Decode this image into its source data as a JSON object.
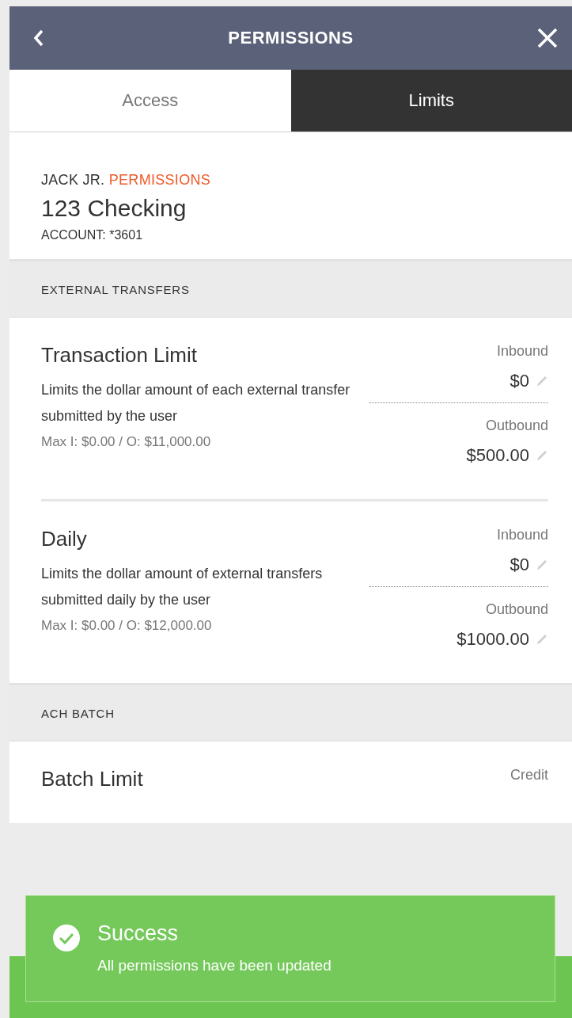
{
  "header": {
    "title": "PERMISSIONS"
  },
  "tabs": [
    {
      "label": "Access",
      "selected": false
    },
    {
      "label": "Limits",
      "selected": true
    }
  ],
  "account": {
    "owner": "JACK JR.",
    "label": "PERMISSIONS",
    "name": "123 Checking",
    "number": "ACCOUNT: *3601"
  },
  "sections": [
    {
      "title": "EXTERNAL TRANSFERS",
      "limits": [
        {
          "title": "Transaction Limit",
          "description": "Limits the dollar amount of each external transfer submitted by the user",
          "max": "Max I: $0.00 / O: $11,000.00",
          "fields": [
            {
              "label": "Inbound",
              "value": "$0"
            },
            {
              "label": "Outbound",
              "value": "$500.00"
            }
          ]
        },
        {
          "title": "Daily",
          "description": "Limits the dollar amount of external transfers submitted daily by the user",
          "max": "Max I: $0.00 / O: $12,000.00",
          "fields": [
            {
              "label": "Inbound",
              "value": "$0"
            },
            {
              "label": "Outbound",
              "value": "$1000.00"
            }
          ]
        }
      ]
    },
    {
      "title": "ACH BATCH",
      "limits": [
        {
          "title": "Batch Limit",
          "fields": [
            {
              "label": "Credit"
            }
          ]
        }
      ]
    }
  ],
  "toast": {
    "title": "Success",
    "message": "All permissions have been updated"
  }
}
